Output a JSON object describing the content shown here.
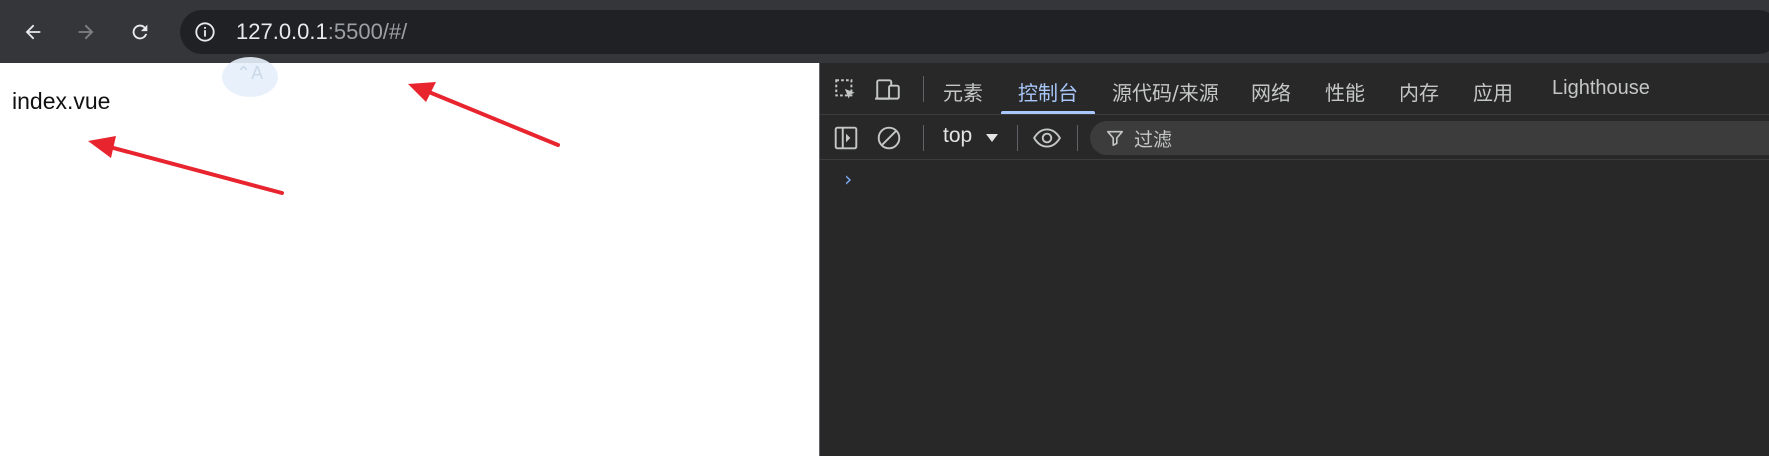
{
  "browser": {
    "address_host": "127.0.0.1",
    "address_rest": ":5500/#/"
  },
  "page": {
    "content_text": "index.vue",
    "translate_glyph": "⌃A"
  },
  "devtools": {
    "tabs": [
      "元素",
      "控制台",
      "源代码/来源",
      "网络",
      "性能",
      "内存",
      "应用",
      "Lighthouse"
    ],
    "active_tab": "控制台",
    "context": "top",
    "filter_placeholder": "过滤",
    "prompt_glyph": "›"
  },
  "colors": {
    "annotation_arrow": "#e8242f",
    "active_tab": "#a8c7fa"
  }
}
